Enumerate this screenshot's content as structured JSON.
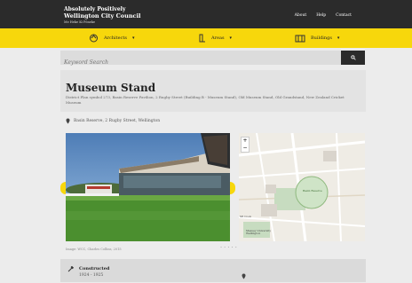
{
  "header": {
    "logo_line1": "Absolutely Positively",
    "logo_line2": "Wellington City Council",
    "logo_line3": "Me Heke Ki Pōneke",
    "nav": [
      "About",
      "Help",
      "Contact"
    ]
  },
  "categories": [
    {
      "label": "Architects",
      "icon": "architect-icon"
    },
    {
      "label": "Areas",
      "icon": "area-icon"
    },
    {
      "label": "Buildings",
      "icon": "buildings-icon"
    }
  ],
  "search": {
    "placeholder": "Keyword Search"
  },
  "page": {
    "title": "Museum Stand",
    "description": "District Plan symbol 273, Basin Reserve Pavilion, 2 Rugby Street (Building B - Museum Stand), Old Museum Stand, Old Grandstand, New Zealand Cricket Museum",
    "address": "Basin Reserve, 2 Rugby Street, Wellington"
  },
  "photo": {
    "caption": "Image: WCC, Charles Collins, 2015"
  },
  "map": {
    "labels": [
      "Basin Reserve",
      "Mt Cook",
      "Massey University Wellington"
    ]
  },
  "details": {
    "constructed_label": "Constructed",
    "constructed_years": "1924 - 1925"
  },
  "colors": {
    "accent": "#f7d70c",
    "dark": "#2b2b2b"
  }
}
